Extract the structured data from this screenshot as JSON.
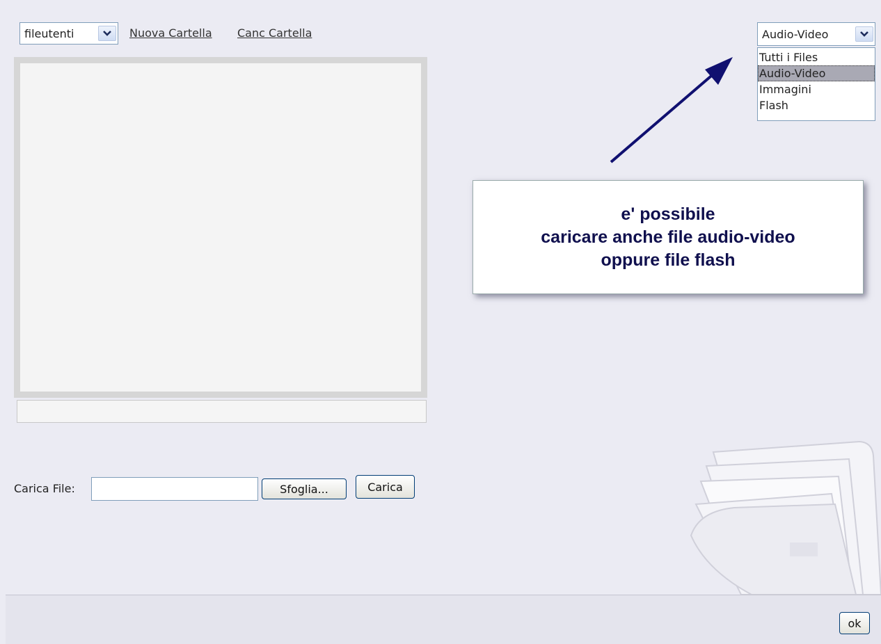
{
  "toolbar": {
    "folder_select_value": "fileutenti",
    "new_folder_link": "Nuova Cartella",
    "delete_folder_link": "Canc Cartella",
    "type_select_value": "Audio-Video"
  },
  "type_dropdown": {
    "options": [
      "Tutti i Files",
      "Audio-Video",
      "Immagini",
      "Flash"
    ],
    "selected": "Audio-Video"
  },
  "callout": {
    "lines": [
      "e' possibile",
      "caricare anche file audio-video",
      "oppure file flash"
    ]
  },
  "upload": {
    "label": "Carica File:",
    "file_value": "",
    "browse_label": "Sfoglia...",
    "upload_label": "Carica"
  },
  "footer": {
    "ok_label": "ok"
  },
  "icons": {
    "arrow": "arrow-icon",
    "folder": "folder-icon",
    "dropdown": "chevron-down-icon"
  },
  "colors": {
    "background": "#ebebf3",
    "callout_text": "#10104e",
    "arrow": "#101070"
  }
}
